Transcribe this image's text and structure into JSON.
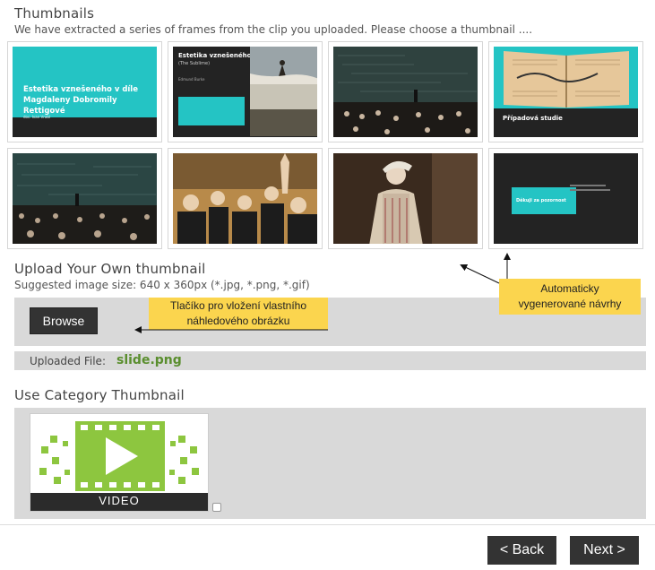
{
  "thumbnails_section": {
    "title": "Thumbnails",
    "description": "We have extracted a series of frames from the clip you uploaded. Please choose a thumbnail ....",
    "frames": [
      {
        "title": "Estetika vznešeného v díle Magdaleny Dobromily Rettigové",
        "caption": "doc. Ivan Vrabl"
      },
      {
        "title": "Estetika vznešeného",
        "subtitle": "(The Sublime)",
        "author": "Edmund Burke"
      },
      {
        "title": ""
      },
      {
        "title": "Případová studie"
      },
      {
        "title": ""
      },
      {
        "title": ""
      },
      {
        "title": ""
      },
      {
        "title": "Děkuji za pozornost"
      }
    ]
  },
  "upload_section": {
    "title": "Upload Your Own thumbnail",
    "hint": "Suggested image size: 640 x 360px (*.jpg, *.png, *.gif)",
    "browse_label": "Browse",
    "uploaded_label": "Uploaded File:",
    "uploaded_value": "slide.png"
  },
  "category_section": {
    "title": "Use Category Thumbnail",
    "image_label": "VIDEO"
  },
  "annotations": {
    "browse_note": "Tlačíko pro vložení vlastního náhledového obrázku",
    "auto_note": "Automaticky vygenerované návrhy"
  },
  "navigation": {
    "back_label": "< Back",
    "next_label": "Next >"
  },
  "colors": {
    "accent_teal": "#24c4c4",
    "note_yellow": "#fbd54e",
    "filename_green": "#5a8e2e",
    "video_green": "#8dc63f"
  }
}
